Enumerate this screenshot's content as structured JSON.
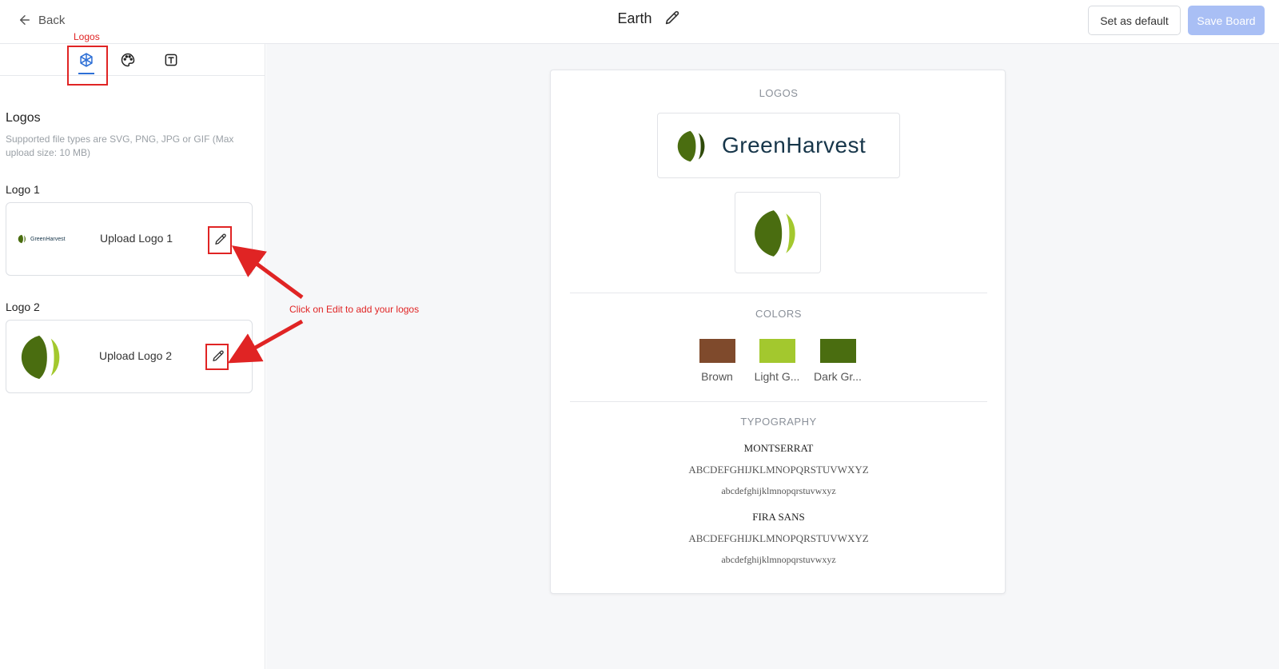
{
  "header": {
    "back_label": "Back",
    "board_title": "Earth",
    "set_default_label": "Set as default",
    "save_label": "Save Board"
  },
  "sidebar": {
    "tabs": [
      {
        "icon": "logo-asset-icon",
        "active": true
      },
      {
        "icon": "palette-icon",
        "active": false
      },
      {
        "icon": "text-type-icon",
        "active": false
      }
    ],
    "annotation_tab_label": "Logos",
    "section_title": "Logos",
    "section_desc": "Supported file types are SVG, PNG, JPG or GIF (Max upload size: 10 MB)",
    "logos": [
      {
        "label": "Logo 1",
        "upload_text": "Upload Logo 1",
        "thumb_wordmark": "GreenHarvest"
      },
      {
        "label": "Logo 2",
        "upload_text": "Upload Logo 2"
      }
    ],
    "annotation_text": "Click on Edit to add your logos"
  },
  "preview": {
    "logos_heading": "LOGOS",
    "wordmark": "GreenHarvest",
    "colors_heading": "COLORS",
    "colors": [
      {
        "name": "Brown",
        "hex": "#7f4a2c"
      },
      {
        "name": "Light G...",
        "hex": "#a3c82e"
      },
      {
        "name": "Dark Gr...",
        "hex": "#4a6d10"
      }
    ],
    "typography_heading": "TYPOGRAPHY",
    "fonts": [
      {
        "name": "MONTSERRAT",
        "upper": "ABCDEFGHIJKLMNOPQRSTUVWXYZ",
        "lower": "abcdefghijklmnopqrstuvwxyz"
      },
      {
        "name": "FIRA SANS",
        "upper": "ABCDEFGHIJKLMNOPQRSTUVWXYZ",
        "lower": "abcdefghijklmnopqrstuvwxyz"
      }
    ]
  },
  "brand_colors": {
    "leaf_dark": "#4a6d10",
    "leaf_light": "#a3c82e",
    "accent": "#2d6fd6",
    "annotation": "#e02424"
  }
}
